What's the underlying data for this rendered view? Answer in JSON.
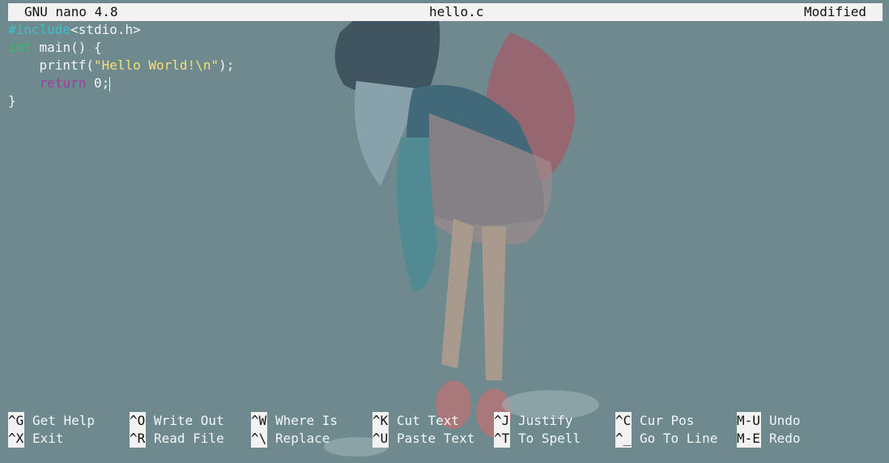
{
  "title_bar": {
    "app": "GNU nano 4.8",
    "file": "hello.c",
    "status": "Modified"
  },
  "editor": {
    "lines": [
      [
        {
          "text": "#include",
          "cls": "c-pre"
        },
        {
          "text": "<stdio.h>",
          "cls": "c-norm"
        }
      ],
      [
        {
          "text": "int",
          "cls": "c-type"
        },
        {
          "text": " main() {",
          "cls": "c-norm"
        }
      ],
      [
        {
          "text": "    printf(",
          "cls": "c-norm"
        },
        {
          "text": "\"Hello World!\\n\"",
          "cls": "c-str"
        },
        {
          "text": ");",
          "cls": "c-norm"
        }
      ],
      [
        {
          "text": "    ",
          "cls": "c-norm"
        },
        {
          "text": "return",
          "cls": "c-kw"
        },
        {
          "text": " 0;",
          "cls": "c-norm"
        }
      ],
      [
        {
          "text": "}",
          "cls": "c-norm"
        }
      ]
    ]
  },
  "shortcuts": {
    "row1": [
      {
        "key": "^G",
        "label": "Get Help"
      },
      {
        "key": "^O",
        "label": "Write Out"
      },
      {
        "key": "^W",
        "label": "Where Is"
      },
      {
        "key": "^K",
        "label": "Cut Text"
      },
      {
        "key": "^J",
        "label": "Justify"
      },
      {
        "key": "^C",
        "label": "Cur Pos"
      },
      {
        "key": "M-U",
        "label": "Undo"
      }
    ],
    "row2": [
      {
        "key": "^X",
        "label": "Exit"
      },
      {
        "key": "^R",
        "label": "Read File"
      },
      {
        "key": "^\\",
        "label": "Replace"
      },
      {
        "key": "^U",
        "label": "Paste Text"
      },
      {
        "key": "^T",
        "label": "To Spell"
      },
      {
        "key": "^_",
        "label": "Go To Line"
      },
      {
        "key": "M-E",
        "label": "Redo"
      }
    ]
  },
  "colors": {
    "background": "#6e8a8f",
    "title_bar": "#f2f2f2",
    "preprocessor": "#39c3c9",
    "type": "#39b86c",
    "string": "#f2e07a",
    "keyword": "#a23a9e"
  }
}
